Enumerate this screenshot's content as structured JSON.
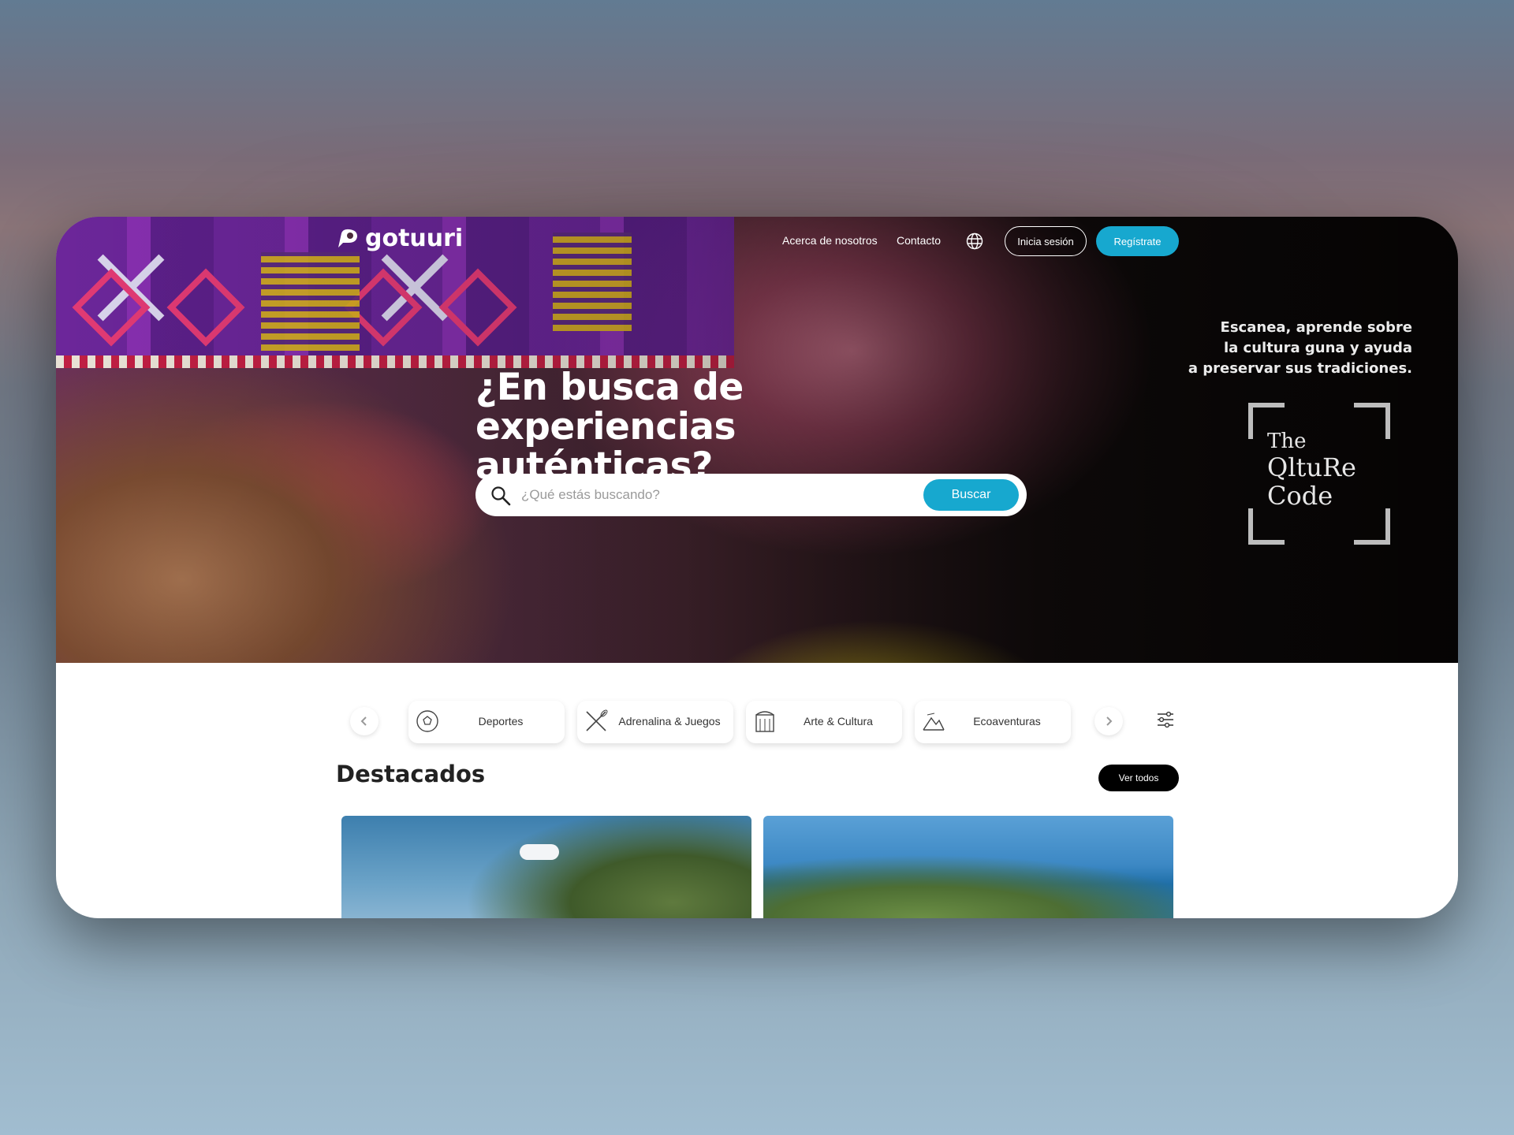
{
  "brand": {
    "name": "gotuuri"
  },
  "nav": {
    "about": "Acerca de nosotros",
    "contact": "Contacto",
    "language_icon": "globe-icon",
    "login": "Inicia sesión",
    "register": "Regístrate"
  },
  "hero": {
    "title": "¿En busca de experiencias auténticas?",
    "search": {
      "placeholder": "¿Qué estás buscando?",
      "value": "",
      "button": "Buscar"
    },
    "promo": {
      "line1": "Escanea, aprende sobre",
      "line2": "la cultura guna y ayuda",
      "line3": "a preservar sus tradiciones.",
      "logo_line1": "The",
      "logo_line2": "QltuRe",
      "logo_line3": "Code"
    }
  },
  "categories": [
    {
      "label": "Deportes",
      "icon": "soccer-ball-icon"
    },
    {
      "label": "Adrenalina & Juegos",
      "icon": "kayak-paddle-icon"
    },
    {
      "label": "Arte & Cultura",
      "icon": "building-icon"
    },
    {
      "label": "Ecoaventuras",
      "icon": "mountain-icon"
    }
  ],
  "featured": {
    "title": "Destacados",
    "view_all": "Ver todos"
  },
  "colors": {
    "accent": "#17a8cf",
    "dark": "#000000"
  }
}
